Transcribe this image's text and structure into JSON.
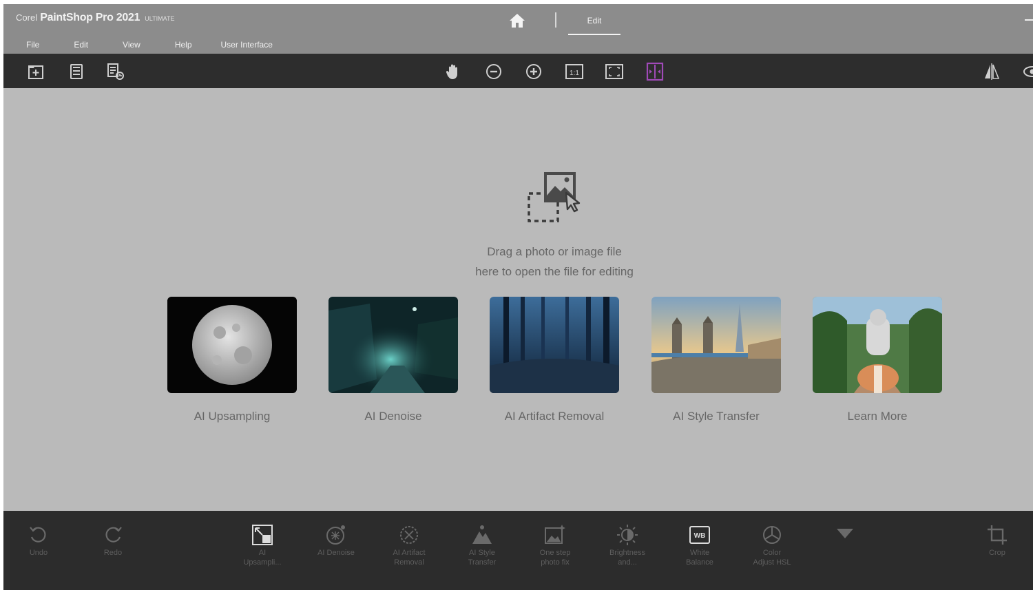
{
  "titlebar": {
    "brand_prefix": "Corel",
    "brand_name": "PaintShop Pro 2021",
    "brand_edition": "ULTIMATE",
    "home_icon": "home-icon",
    "active_tab": "Edit"
  },
  "menu": [
    "File",
    "Edit",
    "View",
    "Help",
    "User Interface"
  ],
  "toolbar": {
    "left_icons": [
      "open-file-icon",
      "save-icon",
      "batch-process-icon"
    ],
    "center_icons": [
      "pan-hand-icon",
      "zoom-out-icon",
      "zoom-in-icon",
      "actual-size-icon",
      "fit-to-window-icon",
      "before-after-icon"
    ],
    "right_icons": [
      "mirror-icon",
      "view-icon"
    ]
  },
  "dropzone": {
    "icon": "drag-image-icon",
    "line1": "Drag a photo or image file",
    "line2": "here to open the file for editing"
  },
  "cards": [
    {
      "label": "AI Upsampling"
    },
    {
      "label": "AI Denoise"
    },
    {
      "label": "AI Artifact Removal"
    },
    {
      "label": "AI Style Transfer"
    },
    {
      "label": "Learn More"
    }
  ],
  "bottombar": {
    "undo": "Undo",
    "redo": "Redo",
    "tools": [
      {
        "line1": "AI",
        "line2": "Upsampli..."
      },
      {
        "line1": "AI Denoise",
        "line2": ""
      },
      {
        "line1": "AI Artifact",
        "line2": "Removal"
      },
      {
        "line1": "AI Style",
        "line2": "Transfer"
      },
      {
        "line1": "One step",
        "line2": "photo fix"
      },
      {
        "line1": "Brightness",
        "line2": "and..."
      },
      {
        "line1": "White",
        "line2": "Balance"
      },
      {
        "line1": "Color",
        "line2": "Adjust HSL"
      }
    ],
    "more_icon": "expand-triangle-icon",
    "crop": "Crop"
  },
  "colors": {
    "titlebar": "#8c8c8c",
    "toolbar": "#2d2d2d",
    "workspace": "#bababa",
    "accent_purple": "#a04ab8"
  }
}
